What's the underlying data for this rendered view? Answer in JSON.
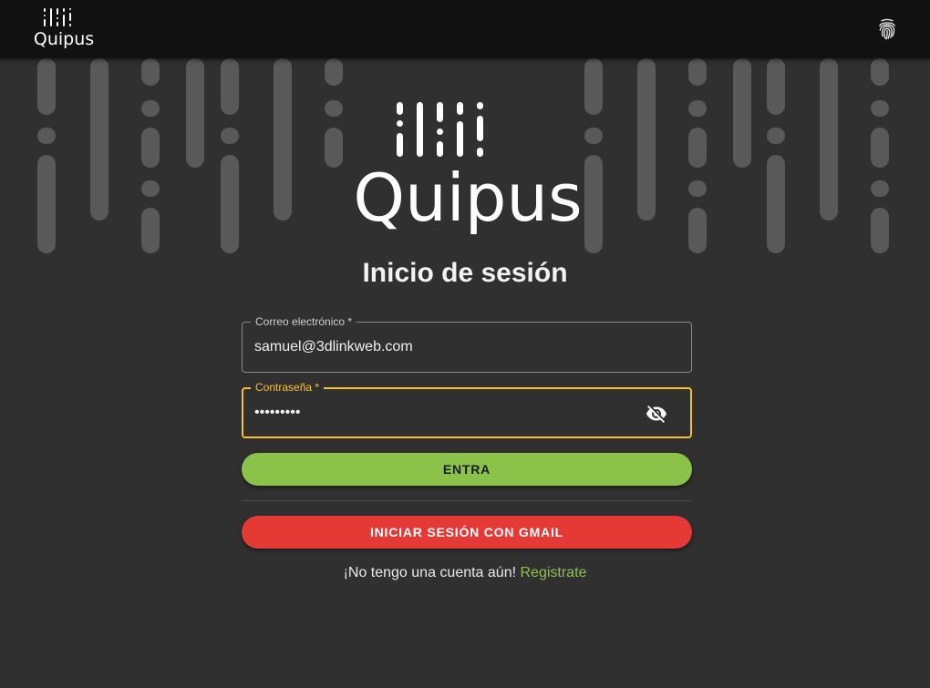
{
  "header": {
    "logo_text": "Quipus",
    "fingerprint_icon": "fingerprint-icon"
  },
  "hero": {
    "logo_text": "Quipus"
  },
  "login": {
    "title": "Inicio de sesión",
    "email": {
      "label": "Correo electrónico *",
      "value": "samuel@3dlinkweb.com"
    },
    "password": {
      "label": "Contraseña *",
      "value": "•••••••••",
      "toggle_icon": "eye-off-icon"
    },
    "submit_label": "ENTRA",
    "gmail_label": "INICIAR SESIÓN CON GMAIL",
    "signup_prompt": "¡No tengo una cuenta aún!",
    "signup_link": "Registrate"
  },
  "colors": {
    "background": "#303030",
    "appbar": "#111111",
    "accent_green": "#8bc34a",
    "accent_red": "#e53935",
    "focus_yellow": "#fbc02d"
  }
}
